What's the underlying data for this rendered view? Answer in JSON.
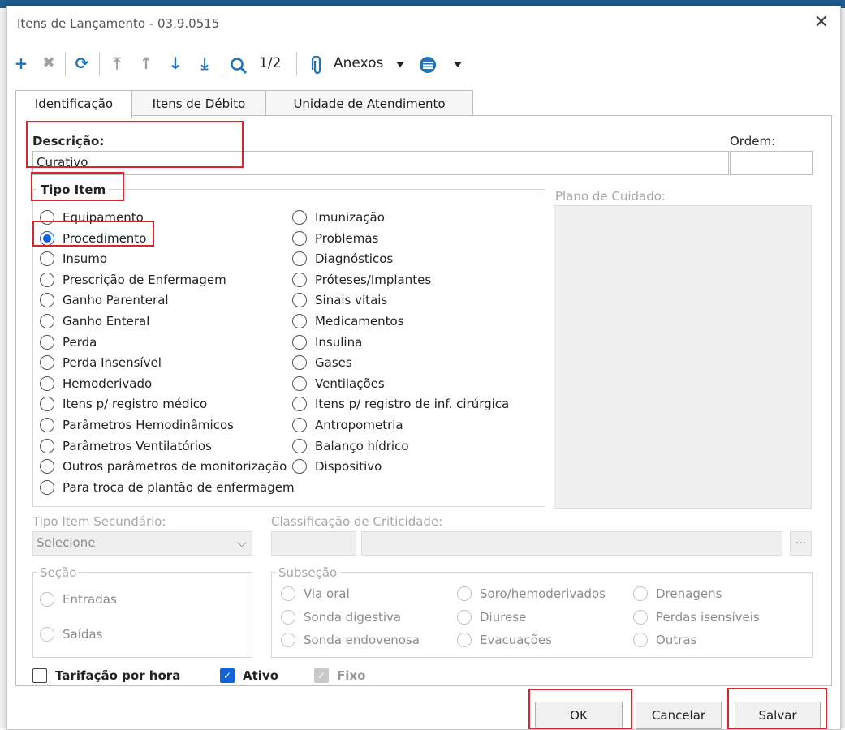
{
  "dialog": {
    "title": "Itens de Lançamento - 03.9.0515"
  },
  "toolbar": {
    "add_icon": "plus-icon",
    "delete_icon": "x-icon",
    "refresh_icon": "refresh-icon",
    "first_icon": "arrow-first-icon",
    "up_icon": "arrow-up-icon",
    "down_icon": "arrow-down-icon",
    "last_icon": "arrow-last-icon",
    "search_icon": "search-icon",
    "pager": "1/2",
    "attachments_label": "Anexos",
    "extra_icon": "menu-icon"
  },
  "tabs": [
    {
      "label": "Identificação",
      "active": true
    },
    {
      "label": "Itens de Débito",
      "active": false
    },
    {
      "label": "Unidade de Atendimento",
      "active": false
    }
  ],
  "form": {
    "descricao_label": "Descrição:",
    "descricao_value": "Curativo",
    "ordem_label": "Ordem:",
    "ordem_value": "",
    "tipo_item_label": "Tipo Item",
    "plano_label": "Plano de Cuidado:",
    "tipo_items_col1": [
      "Equipamento",
      "Procedimento",
      "Insumo",
      "Prescrição de Enfermagem",
      "Ganho Parenteral",
      "Ganho Enteral",
      "Perda",
      "Perda Insensível",
      "Hemoderivado",
      "Itens p/ registro médico",
      "Parâmetros Hemodinâmicos",
      "Parâmetros Ventilatórios",
      "Outros parâmetros de monitorização",
      "Para troca de plantão de enfermagem"
    ],
    "tipo_items_col2": [
      "Imunização",
      "Problemas",
      "Diagnósticos",
      "Próteses/Implantes",
      "Sinais vitais",
      "Medicamentos",
      "Insulina",
      "Gases",
      "Ventilações",
      "Itens p/ registro de inf. cirúrgica",
      "Antropometria",
      "Balanço hídrico",
      "Dispositivo"
    ],
    "tipo_selected": "Procedimento",
    "tipo_secundario_label": "Tipo Item Secundário:",
    "tipo_secundario_value": "Selecione",
    "classificacao_label": "Classificação de Criticidade:",
    "classificacao_btn": "...",
    "secao_label": "Seção",
    "secao_items": [
      "Entradas",
      "Saídas"
    ],
    "subsecao_label": "Subseção",
    "subsecao_col1": [
      "Via oral",
      "Sonda digestiva",
      "Sonda endovenosa"
    ],
    "subsecao_col2": [
      "Soro/hemoderivados",
      "Diurese",
      "Evacuações"
    ],
    "subsecao_col3": [
      "Drenagens",
      "Perdas isensíveis",
      "Outras"
    ],
    "tarifacao_label": "Tarifação por hora",
    "tarifacao_checked": false,
    "ativo_label": "Ativo",
    "ativo_checked": true,
    "fixo_label": "Fixo",
    "fixo_checked": true
  },
  "buttons": {
    "ok": "OK",
    "cancelar": "Cancelar",
    "salvar": "Salvar"
  },
  "colors": {
    "accent": "#0f62d8",
    "highlight": "#d9262e",
    "toolbar_icon": "#1e73be"
  }
}
